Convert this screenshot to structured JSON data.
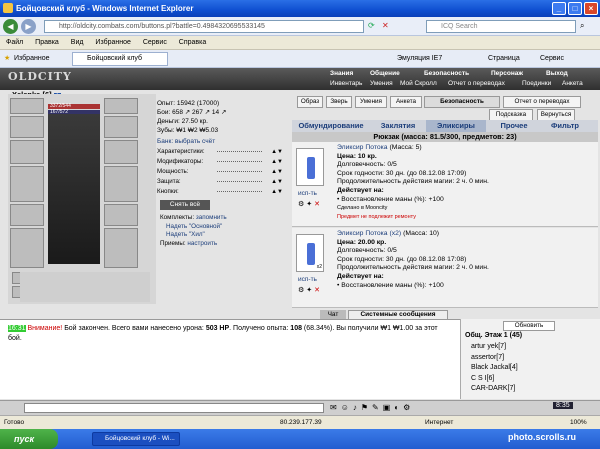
{
  "window": {
    "title": "Бойцовский клуб - Windows Internet Explorer",
    "min": "_",
    "max": "□",
    "close": "×"
  },
  "address": {
    "url": "http://oldcity.combats.com/buttons.pl?battle=0.4984320695533145",
    "search_placeholder": "ICQ Search"
  },
  "menu": [
    "Файл",
    "Правка",
    "Вид",
    "Избранное",
    "Сервис",
    "Справка"
  ],
  "favbar": {
    "favorites": "Избранное",
    "tab": "Бойцовский клуб",
    "emul": "Эмуляция IE7",
    "page": "Страница",
    "tools": "Сервис"
  },
  "game_nav": {
    "logo": "OLDCITY",
    "row1": [
      "Знания",
      "Общение",
      "Безопасность",
      "Персонаж",
      "Выход"
    ],
    "row2": [
      "Инвентарь",
      "Умения",
      "Мой Скролл",
      "Отчет о переводах",
      "Поединки",
      "Анкета"
    ]
  },
  "character": {
    "name": "Xelenka",
    "level": "[6]",
    "hp": "3372/544",
    "mana": "167/572"
  },
  "stats": {
    "exp": "Опыт: 15942 (17000)",
    "battles": "Бои:  658 ↗  267 ↗  14 ↗",
    "money": "Деньги: 27.50 кр.",
    "teeth": "Зубы: ₩1 ₩2 ₩5.03"
  },
  "bank": "Банк: выбрать счёт",
  "sections": [
    "Характеристики:",
    "Модификаторы:",
    "Мощность:",
    "Защита:",
    "Кнопки:"
  ],
  "remove_all": "Снять всё",
  "sets": {
    "label": "Комплекты:",
    "remember": "запомнить",
    "set1": "Надеть \"Основной\"",
    "set2": "Надеть \"Хил\""
  },
  "tricks": {
    "label": "Приемы:",
    "configure": "настроить"
  },
  "top_tabs": [
    "Образ",
    "Зверь",
    "Умения",
    "Анкета",
    "Безопасность",
    "Отчет о переводах"
  ],
  "sub_tabs": [
    "Подсказка",
    "Вернуться"
  ],
  "inv_tabs": [
    "Обмундирование",
    "Заклятия",
    "Эликсиры",
    "Прочее",
    "Фильтр"
  ],
  "inventory_title": "Рюкзак (масса: 81.5/300, предметов: 23)",
  "items": [
    {
      "name": "Эликсир Потока",
      "mass": "(Масса: 5)",
      "price": "Цена: 10 кр.",
      "durability": "Долговечность: 0/5",
      "expiry": "Срок годности: 30 дн. (до 08.12.08 17:09)",
      "duration": "Продолжительность действия магии: 2 ч. 0 мин.",
      "acts": "Действует на:",
      "effect": "• Восстановление маны (%): +100",
      "made": "Сделано в Mooncity",
      "note": "Предмет не подлежит ремонту",
      "use": "исп-ть"
    },
    {
      "name": "Эликсир Потока (x2)",
      "mass": "(Масса: 10)",
      "price": "Цена: 20.00 кр.",
      "durability": "Долговечность: 0/5",
      "expiry": "Срок годности: 30 дн. (до 08.12.08 17:08)",
      "duration": "Продолжительность действия магии: 2 ч. 0 мин.",
      "acts": "Действует на:",
      "effect": "• Восстановление маны (%): +100",
      "made": "",
      "note": "",
      "use": "исп-ть",
      "count": "x2"
    }
  ],
  "chat": {
    "tabs": [
      "Чат",
      "Системные сообщения"
    ],
    "time": "16:31",
    "warn": "Внимание!",
    "msg1": " Бой закончен. Всего вами нанесено урона: ",
    "dmg": "503 HP",
    "msg2": ". Получено опыта: ",
    "exp": "108",
    "msg3": " (68.34%). Вы получили ₩1 ₩1.00 за этот бой."
  },
  "online": {
    "refresh": "Обновить",
    "location": "Общ. Этаж 1 (45)",
    "users": [
      "artur yek[7]",
      "assertor[7]",
      "Black Jackal[4]",
      "C S I[6]",
      "CAR-DARK[7]"
    ]
  },
  "clock": "8:35",
  "status": {
    "left": "Готово",
    "ip": "80.239.177.39",
    "zone": "Интернет",
    "zoom": "100%"
  },
  "taskbar": {
    "start": "пуск",
    "item": "Бойцовский клуб - Wi...",
    "watermark": "photo.scrolls.ru"
  }
}
